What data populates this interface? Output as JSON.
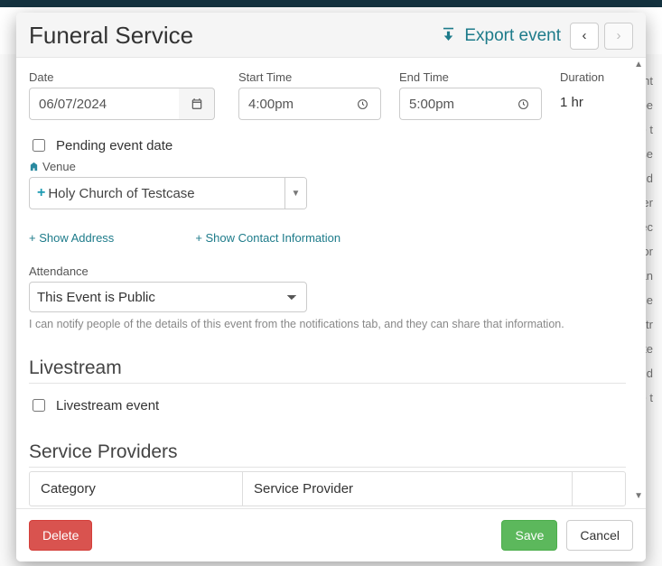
{
  "modal": {
    "title": "Funeral Service",
    "export_label": "Export event"
  },
  "dates": {
    "date_label": "Date",
    "date_value": "06/07/2024",
    "start_label": "Start Time",
    "start_value": "4:00pm",
    "end_label": "End Time",
    "end_value": "5:00pm",
    "duration_label": "Duration",
    "duration_value": "1 hr"
  },
  "pending": {
    "label": "Pending event date",
    "checked": false
  },
  "venue": {
    "label": "Venue",
    "value": "Holy Church of Testcase"
  },
  "links": {
    "show_address": "+ Show Address",
    "show_contact": "+ Show Contact Information"
  },
  "attendance": {
    "label": "Attendance",
    "value": "This Event is Public",
    "hint": "I can notify people of the details of this event from the notifications tab, and they can share that information."
  },
  "livestream": {
    "heading": "Livestream",
    "checkbox_label": "Livestream event",
    "checked": false
  },
  "service_providers": {
    "heading": "Service Providers",
    "columns": {
      "category": "Category",
      "provider": "Service Provider"
    }
  },
  "footer": {
    "delete": "Delete",
    "save": "Save",
    "cancel": "Cancel"
  }
}
